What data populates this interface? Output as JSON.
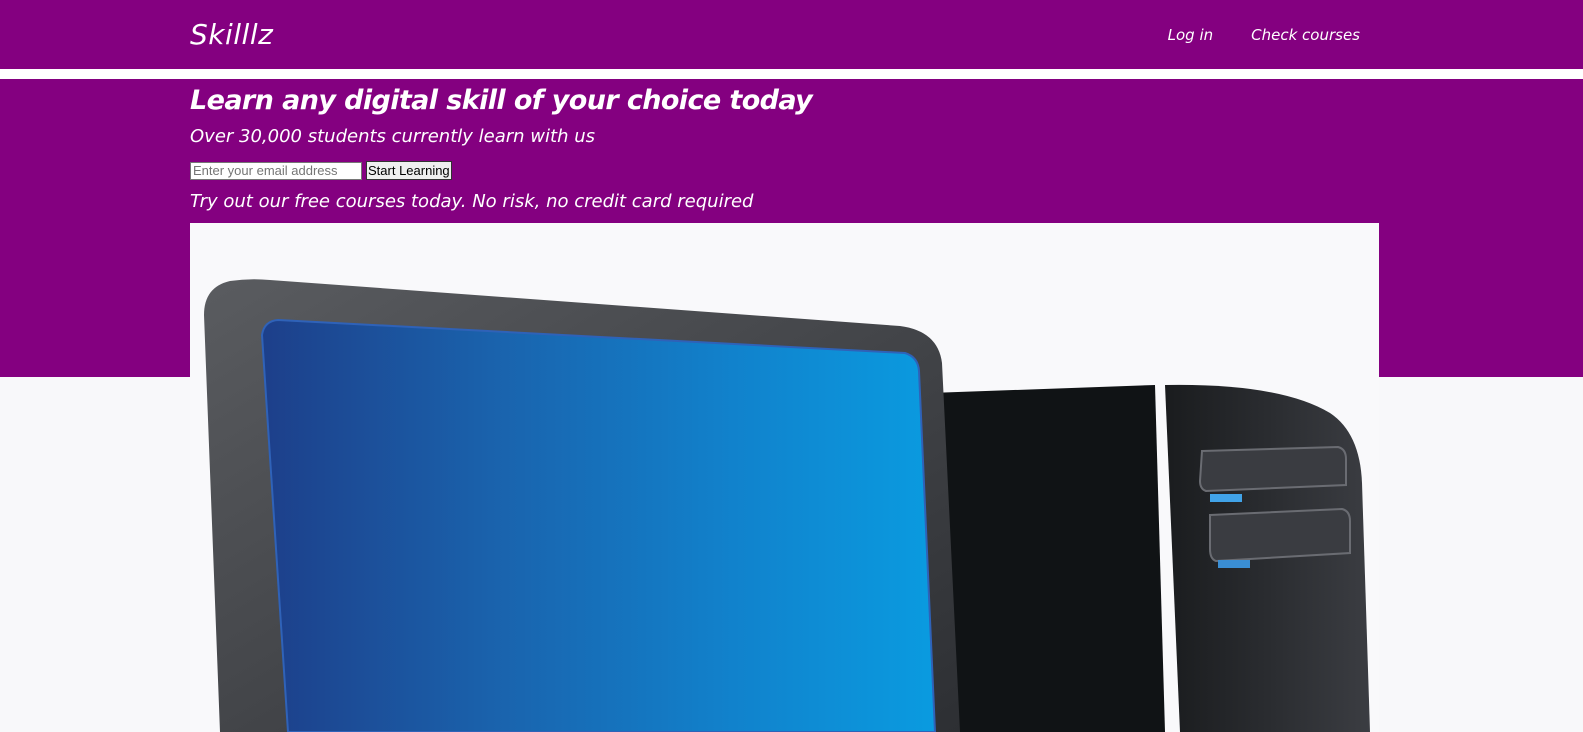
{
  "nav": {
    "brand": "Skilllz",
    "links": [
      "Log in",
      "Check courses"
    ]
  },
  "hero": {
    "title": "Learn any digital skill of your choice today",
    "subtitle": "Over 30,000 students currently learn with us",
    "email_placeholder": "Enter your email address",
    "button_label": "Start Learning",
    "note": "Try out our free courses today. No risk, no credit card required",
    "image_icon": "desktop-computer-icon"
  },
  "colors": {
    "brand_purple": "#840080",
    "page_background": "#f8f8fa"
  }
}
